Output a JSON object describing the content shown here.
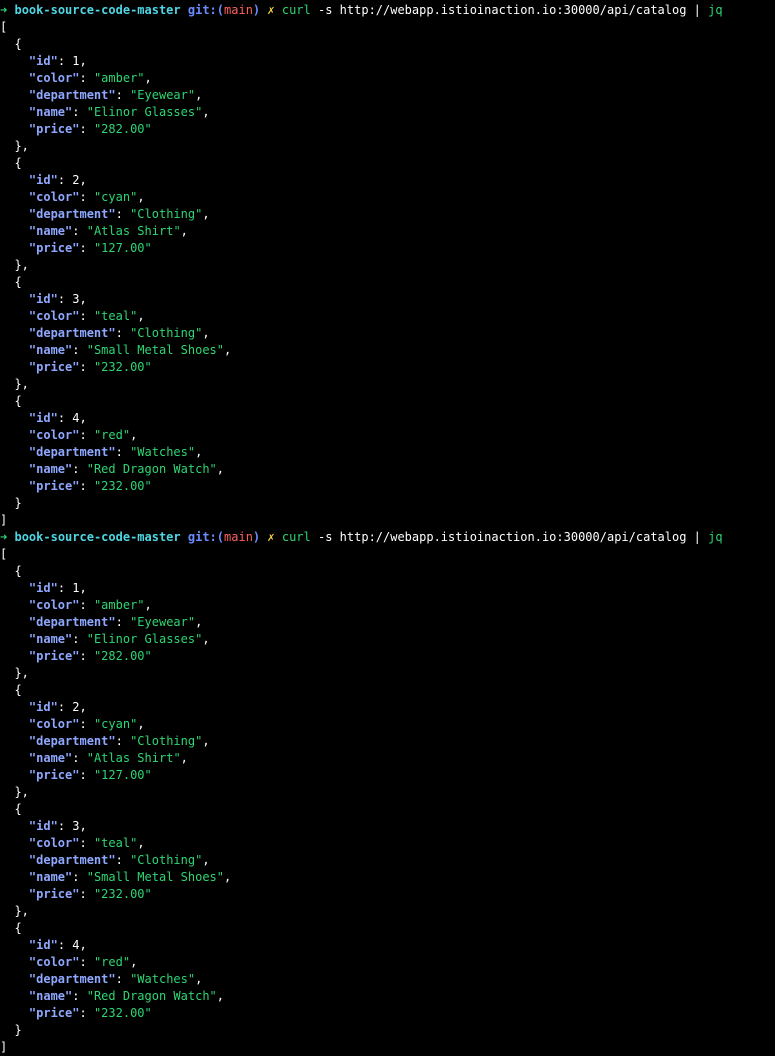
{
  "colors": {
    "background": "#000000",
    "prompt_arrow": "#2ed573",
    "directory": "#4fd6e3",
    "git_label": "#6b8cff",
    "branch": "#ff5f5f",
    "dirty_marker": "#f5d442",
    "command": "#2ed573",
    "json_key": "#8fa8ff",
    "json_string": "#2ed573",
    "json_number": "#ffffff"
  },
  "prompt": {
    "arrow": "➜",
    "directory": "book-source-code-master",
    "git_label": "git:",
    "branch_open": "(",
    "branch": "main",
    "branch_close": ")",
    "dirty_marker": "✗",
    "command_name": "curl",
    "command_args": " -s http://webapp.istioinaction.io:30000/api/catalog | ",
    "pipe_target": "jq"
  },
  "runs": [
    {
      "items": [
        {
          "id": 1,
          "color": "amber",
          "department": "Eyewear",
          "name": "Elinor Glasses",
          "price": "282.00"
        },
        {
          "id": 2,
          "color": "cyan",
          "department": "Clothing",
          "name": "Atlas Shirt",
          "price": "127.00"
        },
        {
          "id": 3,
          "color": "teal",
          "department": "Clothing",
          "name": "Small Metal Shoes",
          "price": "232.00"
        },
        {
          "id": 4,
          "color": "red",
          "department": "Watches",
          "name": "Red Dragon Watch",
          "price": "232.00"
        }
      ]
    },
    {
      "items": [
        {
          "id": 1,
          "color": "amber",
          "department": "Eyewear",
          "name": "Elinor Glasses",
          "price": "282.00"
        },
        {
          "id": 2,
          "color": "cyan",
          "department": "Clothing",
          "name": "Atlas Shirt",
          "price": "127.00"
        },
        {
          "id": 3,
          "color": "teal",
          "department": "Clothing",
          "name": "Small Metal Shoes",
          "price": "232.00"
        },
        {
          "id": 4,
          "color": "red",
          "department": "Watches",
          "name": "Red Dragon Watch",
          "price": "232.00"
        }
      ]
    }
  ]
}
